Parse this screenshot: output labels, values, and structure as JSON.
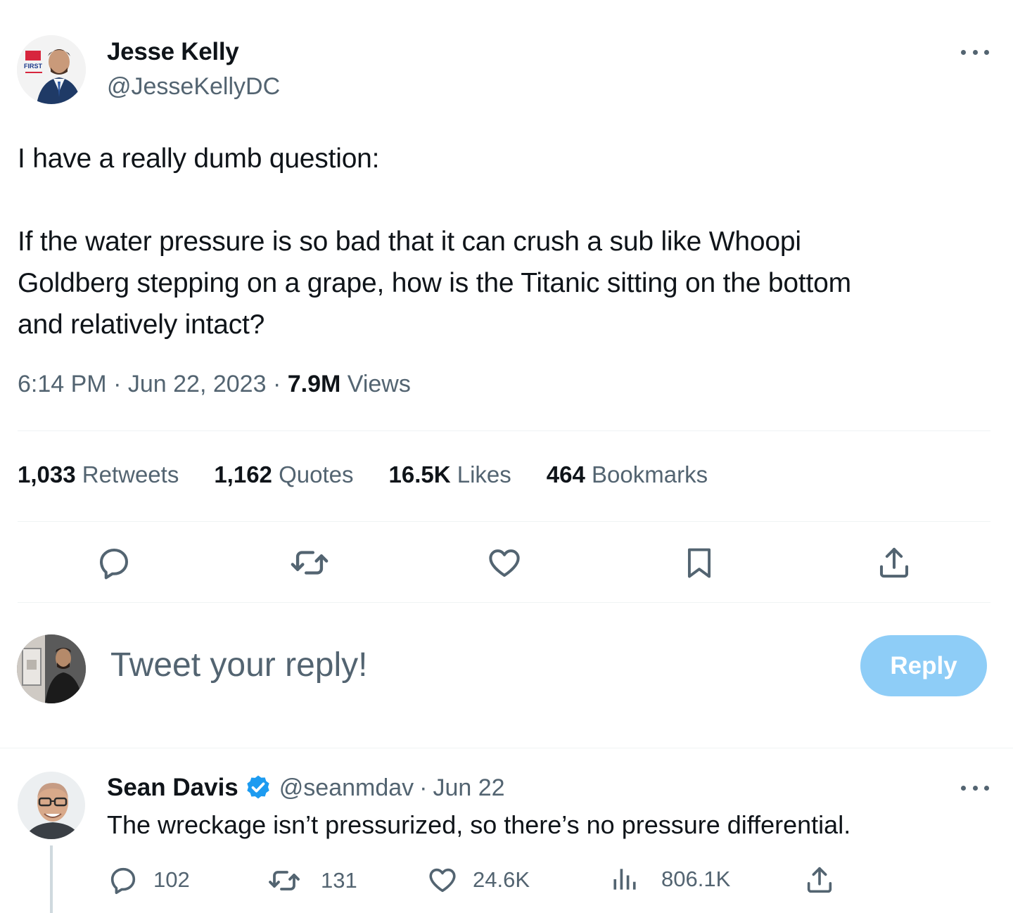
{
  "tweet": {
    "author_name": "Jesse Kelly",
    "author_handle": "@JesseKellyDC",
    "avatar_badge": "FIRST",
    "text_line1": "I have a really dumb question:",
    "text_line2": "If the water pressure is so bad that it can crush a sub like Whoopi",
    "text_line3": "Goldberg stepping on a grape, how is the Titanic sitting on the bottom",
    "text_line4": "and relatively intact?",
    "time": "6:14 PM",
    "date": "Jun 22, 2023",
    "views_count": "7.9M",
    "views_label": "Views",
    "stats": {
      "retweets_count": "1,033",
      "retweets_label": "Retweets",
      "quotes_count": "1,162",
      "quotes_label": "Quotes",
      "likes_count": "16.5K",
      "likes_label": "Likes",
      "bookmarks_count": "464",
      "bookmarks_label": "Bookmarks"
    }
  },
  "composer": {
    "placeholder": "Tweet your reply!",
    "reply_label": "Reply"
  },
  "reply": {
    "author_name": "Sean Davis",
    "author_handle": "@seanmdav",
    "date": "Jun 22",
    "text": "The wreckage isn’t pressurized, so there’s no pressure differential.",
    "replies": "102",
    "retweets": "131",
    "likes": "24.6K",
    "views": "806.1K"
  },
  "colors": {
    "text_primary": "#0f1419",
    "text_secondary": "#536471",
    "reply_button": "#8ecdf7",
    "verified": "#1d9bf0",
    "divider": "#eff3f4"
  },
  "icons": [
    "more-icon",
    "reply-icon",
    "retweet-icon",
    "like-icon",
    "bookmark-icon",
    "share-icon",
    "verified-icon",
    "views-icon"
  ]
}
